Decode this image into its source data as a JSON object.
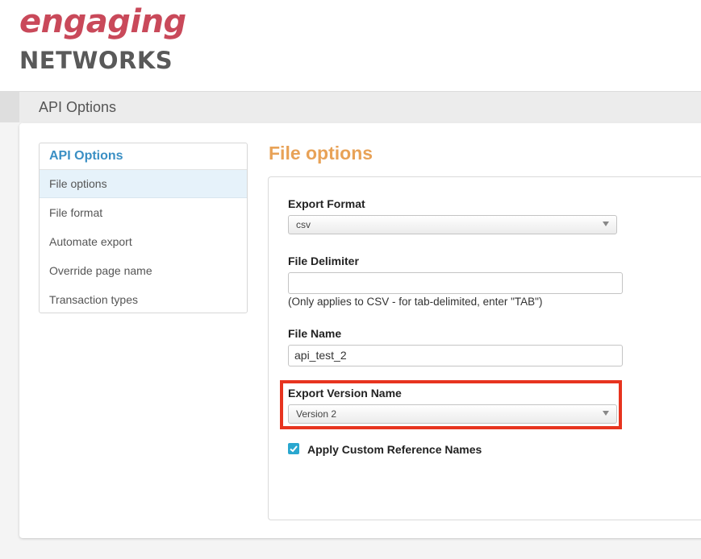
{
  "logo": {
    "top": "engaging",
    "bottom": "NETWORKS"
  },
  "page_title": "API Options",
  "sidebar": {
    "heading": "API Options",
    "items": [
      {
        "label": "File options",
        "active": true
      },
      {
        "label": "File format"
      },
      {
        "label": "Automate export"
      },
      {
        "label": "Override page name"
      },
      {
        "label": "Transaction types"
      }
    ]
  },
  "main": {
    "heading": "File options",
    "export_format": {
      "label": "Export Format",
      "value": "csv"
    },
    "file_delimiter": {
      "label": "File Delimiter",
      "value": "",
      "hint": "(Only applies to CSV - for tab-delimited, enter \"TAB\")"
    },
    "file_name": {
      "label": "File Name",
      "value": "api_test_2"
    },
    "export_version": {
      "label": "Export Version Name",
      "value": "Version 2"
    },
    "apply_custom": {
      "label": "Apply Custom Reference Names",
      "checked": true
    }
  },
  "colors": {
    "brand_pink": "#c9495a",
    "brand_grey": "#595959",
    "accent_blue": "#3a8fc4",
    "heading_orange": "#e8a257",
    "highlight_red": "#e7341f",
    "checkbox_blue": "#2aa7cf"
  },
  "icons": {
    "dropdown": "chevron-down-icon",
    "checkbox": "check-icon"
  }
}
